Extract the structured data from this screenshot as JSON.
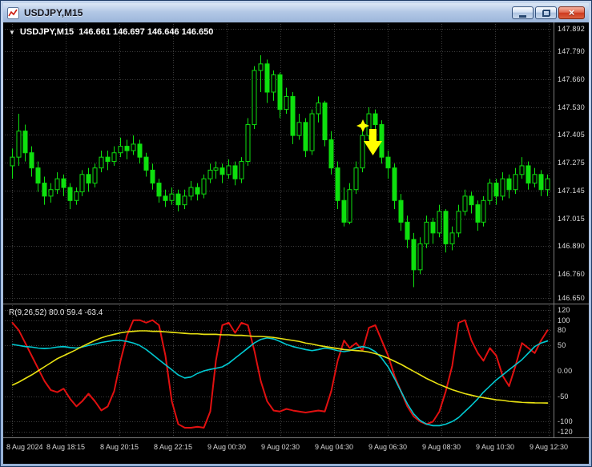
{
  "window": {
    "title": "USDJPY,M15",
    "close_glyph": "×"
  },
  "chart_header": {
    "dropdown_glyph": "▼",
    "symbol": "USDJPY,M15",
    "ohlc": "146.661 146.697 146.646 146.650"
  },
  "indicator_header": {
    "text": "R(9,26,52) 80.0 59.4 -63.4"
  },
  "chart_data": {
    "type": "candlestick",
    "symbol": "USDJPY",
    "timeframe": "M15",
    "price_max": 147.892,
    "price_min": 146.65,
    "grid": true,
    "price_axis_labels": [
      "147.892",
      "147.790",
      "147.660",
      "147.530",
      "147.405",
      "147.275",
      "147.145",
      "147.015",
      "146.890",
      "146.760",
      "146.650"
    ],
    "time_axis_labels": [
      "8 Aug 2024",
      "8 Aug 18:15",
      "8 Aug 20:15",
      "8 Aug 22:15",
      "9 Aug 00:30",
      "9 Aug 02:30",
      "9 Aug 04:30",
      "9 Aug 06:30",
      "9 Aug 08:30",
      "9 Aug 10:30",
      "9 Aug 12:30"
    ],
    "colors": {
      "background": "#000000",
      "grid": "#3e3e3e",
      "candle": "#0ee00e",
      "axis_text": "#dadada",
      "annotation": "#ffff00"
    },
    "candles_ohlc": [
      [
        147.26,
        147.34,
        147.2,
        147.3
      ],
      [
        147.3,
        147.5,
        147.26,
        147.42
      ],
      [
        147.42,
        147.45,
        147.28,
        147.32
      ],
      [
        147.32,
        147.35,
        147.21,
        147.25
      ],
      [
        147.25,
        147.28,
        147.14,
        147.18
      ],
      [
        147.18,
        147.21,
        147.08,
        147.12
      ],
      [
        147.12,
        147.18,
        147.09,
        147.15
      ],
      [
        147.15,
        147.23,
        147.13,
        147.2
      ],
      [
        147.2,
        147.22,
        147.12,
        147.16
      ],
      [
        147.16,
        147.18,
        147.06,
        147.1
      ],
      [
        147.1,
        147.16,
        147.08,
        147.14
      ],
      [
        147.14,
        147.24,
        147.12,
        147.22
      ],
      [
        147.22,
        147.25,
        147.14,
        147.18
      ],
      [
        147.18,
        147.27,
        147.16,
        147.25
      ],
      [
        147.25,
        147.33,
        147.23,
        147.3
      ],
      [
        147.3,
        147.33,
        147.24,
        147.28
      ],
      [
        147.28,
        147.35,
        147.26,
        147.32
      ],
      [
        147.32,
        147.39,
        147.3,
        147.35
      ],
      [
        147.35,
        147.38,
        147.29,
        147.33
      ],
      [
        147.33,
        147.4,
        147.31,
        147.36
      ],
      [
        147.36,
        147.38,
        147.27,
        147.3
      ],
      [
        147.3,
        147.32,
        147.21,
        147.24
      ],
      [
        147.24,
        147.27,
        147.15,
        147.18
      ],
      [
        147.18,
        147.2,
        147.09,
        147.12
      ],
      [
        147.12,
        147.15,
        147.07,
        147.1
      ],
      [
        147.1,
        147.16,
        147.08,
        147.13
      ],
      [
        147.13,
        147.15,
        147.05,
        147.08
      ],
      [
        147.08,
        147.15,
        147.06,
        147.12
      ],
      [
        147.12,
        147.19,
        147.1,
        147.16
      ],
      [
        147.16,
        147.18,
        147.1,
        147.13
      ],
      [
        147.13,
        147.22,
        147.11,
        147.2
      ],
      [
        147.2,
        147.27,
        147.18,
        147.24
      ],
      [
        147.24,
        147.28,
        147.2,
        147.25
      ],
      [
        147.25,
        147.27,
        147.18,
        147.22
      ],
      [
        147.22,
        147.29,
        147.2,
        147.26
      ],
      [
        147.26,
        147.28,
        147.17,
        147.2
      ],
      [
        147.2,
        147.3,
        147.18,
        147.28
      ],
      [
        147.28,
        147.48,
        147.26,
        147.45
      ],
      [
        147.45,
        147.72,
        147.43,
        147.7
      ],
      [
        147.7,
        147.77,
        147.6,
        147.73
      ],
      [
        147.73,
        147.75,
        147.55,
        147.6
      ],
      [
        147.6,
        147.7,
        147.56,
        147.68
      ],
      [
        147.68,
        147.69,
        147.48,
        147.52
      ],
      [
        147.52,
        147.62,
        147.5,
        147.58
      ],
      [
        147.58,
        147.6,
        147.36,
        147.4
      ],
      [
        147.4,
        147.5,
        147.38,
        147.46
      ],
      [
        147.46,
        147.48,
        147.3,
        147.33
      ],
      [
        147.33,
        147.52,
        147.31,
        147.5
      ],
      [
        147.5,
        147.58,
        147.46,
        147.55
      ],
      [
        147.55,
        147.56,
        147.35,
        147.38
      ],
      [
        147.38,
        147.42,
        147.22,
        147.25
      ],
      [
        147.25,
        147.28,
        147.06,
        147.1
      ],
      [
        147.1,
        147.16,
        146.98,
        147.0
      ],
      [
        147.0,
        147.18,
        146.99,
        147.15
      ],
      [
        147.15,
        147.28,
        147.13,
        147.25
      ],
      [
        147.25,
        147.43,
        147.23,
        147.4
      ],
      [
        147.4,
        147.53,
        147.38,
        147.5
      ],
      [
        147.5,
        147.52,
        147.4,
        147.45
      ],
      [
        147.45,
        147.47,
        147.27,
        147.3
      ],
      [
        147.3,
        147.33,
        147.2,
        147.25
      ],
      [
        147.25,
        147.27,
        147.06,
        147.1
      ],
      [
        147.1,
        147.13,
        146.96,
        147.0
      ],
      [
        147.0,
        147.03,
        146.88,
        146.92
      ],
      [
        146.92,
        146.95,
        146.7,
        146.78
      ],
      [
        146.78,
        146.93,
        146.76,
        146.9
      ],
      [
        146.9,
        147.03,
        146.88,
        147.0
      ],
      [
        147.0,
        147.02,
        146.9,
        146.95
      ],
      [
        146.95,
        147.08,
        146.93,
        147.05
      ],
      [
        147.05,
        147.06,
        146.86,
        146.9
      ],
      [
        146.9,
        146.98,
        146.87,
        146.95
      ],
      [
        146.95,
        147.08,
        146.93,
        147.05
      ],
      [
        147.05,
        147.15,
        147.03,
        147.12
      ],
      [
        147.12,
        147.14,
        147.04,
        147.08
      ],
      [
        147.08,
        147.1,
        146.96,
        147.0
      ],
      [
        147.0,
        147.12,
        146.98,
        147.1
      ],
      [
        147.1,
        147.2,
        147.08,
        147.18
      ],
      [
        147.18,
        147.2,
        147.08,
        147.12
      ],
      [
        147.12,
        147.23,
        147.1,
        147.2
      ],
      [
        147.2,
        147.22,
        147.11,
        147.15
      ],
      [
        147.15,
        147.25,
        147.13,
        147.22
      ],
      [
        147.22,
        147.3,
        147.2,
        147.26
      ],
      [
        147.26,
        147.28,
        147.15,
        147.18
      ],
      [
        147.18,
        147.25,
        147.16,
        147.22
      ],
      [
        147.22,
        147.24,
        147.12,
        147.15
      ],
      [
        147.15,
        147.22,
        147.12,
        147.2
      ]
    ],
    "annotation": {
      "name": "sell-signal-arrow",
      "color": "#ffff00",
      "candle_index": 56
    },
    "indicator": {
      "label": "R(9,26,52) 80.0 59.4 -63.4",
      "max": 120,
      "min": -120,
      "axis_labels": [
        "120",
        "100",
        "80",
        "50",
        "0.00",
        "-50",
        "-100",
        "-120"
      ],
      "series": [
        {
          "name": "fast-line",
          "color": "#e01010",
          "width": 2,
          "values": [
            95,
            80,
            55,
            30,
            5,
            -20,
            -38,
            -42,
            -35,
            -55,
            -70,
            -60,
            -45,
            -60,
            -78,
            -70,
            -40,
            20,
            70,
            100,
            100,
            95,
            100,
            90,
            30,
            -60,
            -105,
            -112,
            -112,
            -110,
            -112,
            -80,
            20,
            90,
            95,
            75,
            95,
            90,
            40,
            -20,
            -60,
            -78,
            -80,
            -75,
            -78,
            -80,
            -82,
            -80,
            -78,
            -80,
            -40,
            20,
            60,
            45,
            55,
            40,
            85,
            90,
            60,
            30,
            -10,
            -40,
            -70,
            -90,
            -100,
            -105,
            -100,
            -80,
            -40,
            10,
            95,
            100,
            60,
            35,
            20,
            45,
            30,
            -10,
            -30,
            10,
            55,
            45,
            35,
            60,
            80
          ]
        },
        {
          "name": "mid-line",
          "color": "#00c8d0",
          "width": 1.6,
          "values": [
            52,
            50,
            48,
            47,
            45,
            44,
            45,
            47,
            48,
            46,
            45,
            47,
            50,
            53,
            56,
            58,
            60,
            60,
            58,
            55,
            50,
            42,
            32,
            22,
            12,
            2,
            -8,
            -14,
            -12,
            -5,
            0,
            3,
            5,
            8,
            15,
            25,
            35,
            45,
            55,
            62,
            65,
            63,
            58,
            52,
            48,
            45,
            42,
            40,
            42,
            45,
            43,
            40,
            38,
            40,
            45,
            48,
            45,
            38,
            25,
            8,
            -15,
            -40,
            -65,
            -85,
            -98,
            -105,
            -108,
            -108,
            -105,
            -100,
            -92,
            -80,
            -68,
            -55,
            -42,
            -30,
            -18,
            -8,
            2,
            12,
            22,
            35,
            48,
            55,
            59
          ]
        },
        {
          "name": "slow-line",
          "color": "#e8e112",
          "width": 1.6,
          "values": [
            -28,
            -22,
            -15,
            -8,
            0,
            8,
            16,
            24,
            30,
            36,
            42,
            48,
            54,
            60,
            65,
            69,
            72,
            75,
            77,
            78,
            79,
            79,
            78,
            78,
            77,
            76,
            75,
            74,
            73,
            73,
            72,
            72,
            72,
            71,
            71,
            70,
            70,
            69,
            68,
            68,
            67,
            66,
            64,
            62,
            60,
            58,
            55,
            53,
            50,
            48,
            46,
            44,
            42,
            41,
            40,
            39,
            37,
            34,
            30,
            25,
            19,
            13,
            6,
            -1,
            -8,
            -15,
            -21,
            -27,
            -32,
            -37,
            -41,
            -45,
            -48,
            -51,
            -53,
            -55,
            -57,
            -58,
            -60,
            -61,
            -62,
            -62.5,
            -63,
            -63.2,
            -63.4
          ]
        }
      ]
    }
  }
}
